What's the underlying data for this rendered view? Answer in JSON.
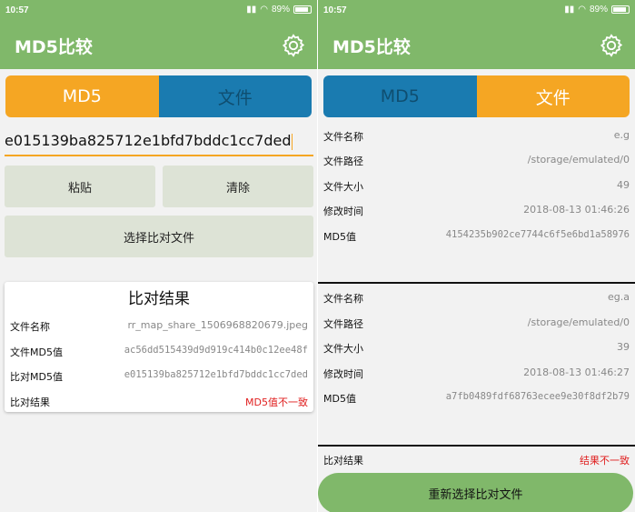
{
  "status": {
    "time": "10:57",
    "battery": "89%"
  },
  "app": {
    "title": "MD5比较"
  },
  "colors": {
    "green": "#80b86a",
    "orange": "#f5a623",
    "blue": "#1a7bb0",
    "red": "#e02020"
  },
  "tabs": {
    "md5": "MD5",
    "file": "文件"
  },
  "left": {
    "md5_value": "e015139ba825712e1bfd7bddc1cc7ded",
    "paste_label": "粘贴",
    "clear_label": "清除",
    "choose_label": "选择比对文件",
    "result": {
      "title": "比对结果",
      "rows": [
        {
          "label": "文件名称",
          "value": "rr_map_share_1506968820679.jpeg"
        },
        {
          "label": "文件MD5值",
          "value": "ac56dd515439d9d919c414b0c12ee48f"
        },
        {
          "label": "比对MD5值",
          "value": "e015139ba825712e1bfd7bddc1cc7ded"
        },
        {
          "label": "比对结果",
          "value": "MD5值不一致"
        }
      ]
    }
  },
  "right": {
    "file1": {
      "name_label": "文件名称",
      "name": "e.g",
      "path_label": "文件路径",
      "path": "/storage/emulated/0",
      "size_label": "文件大小",
      "size": "49",
      "mtime_label": "修改时间",
      "mtime": "2018-08-13 01:46:26",
      "md5_label": "MD5值",
      "md5": "4154235b902ce7744c6f5e6bd1a58976"
    },
    "file2": {
      "name_label": "文件名称",
      "name": "eg.a",
      "path_label": "文件路径",
      "path": "/storage/emulated/0",
      "size_label": "文件大小",
      "size": "39",
      "mtime_label": "修改时间",
      "mtime": "2018-08-13 01:46:27",
      "md5_label": "MD5值",
      "md5": "a7fb0489fdf68763ecee9e30f8df2b79"
    },
    "compare_label": "比对结果",
    "compare_value": "结果不一致",
    "reselect_label": "重新选择比对文件"
  }
}
